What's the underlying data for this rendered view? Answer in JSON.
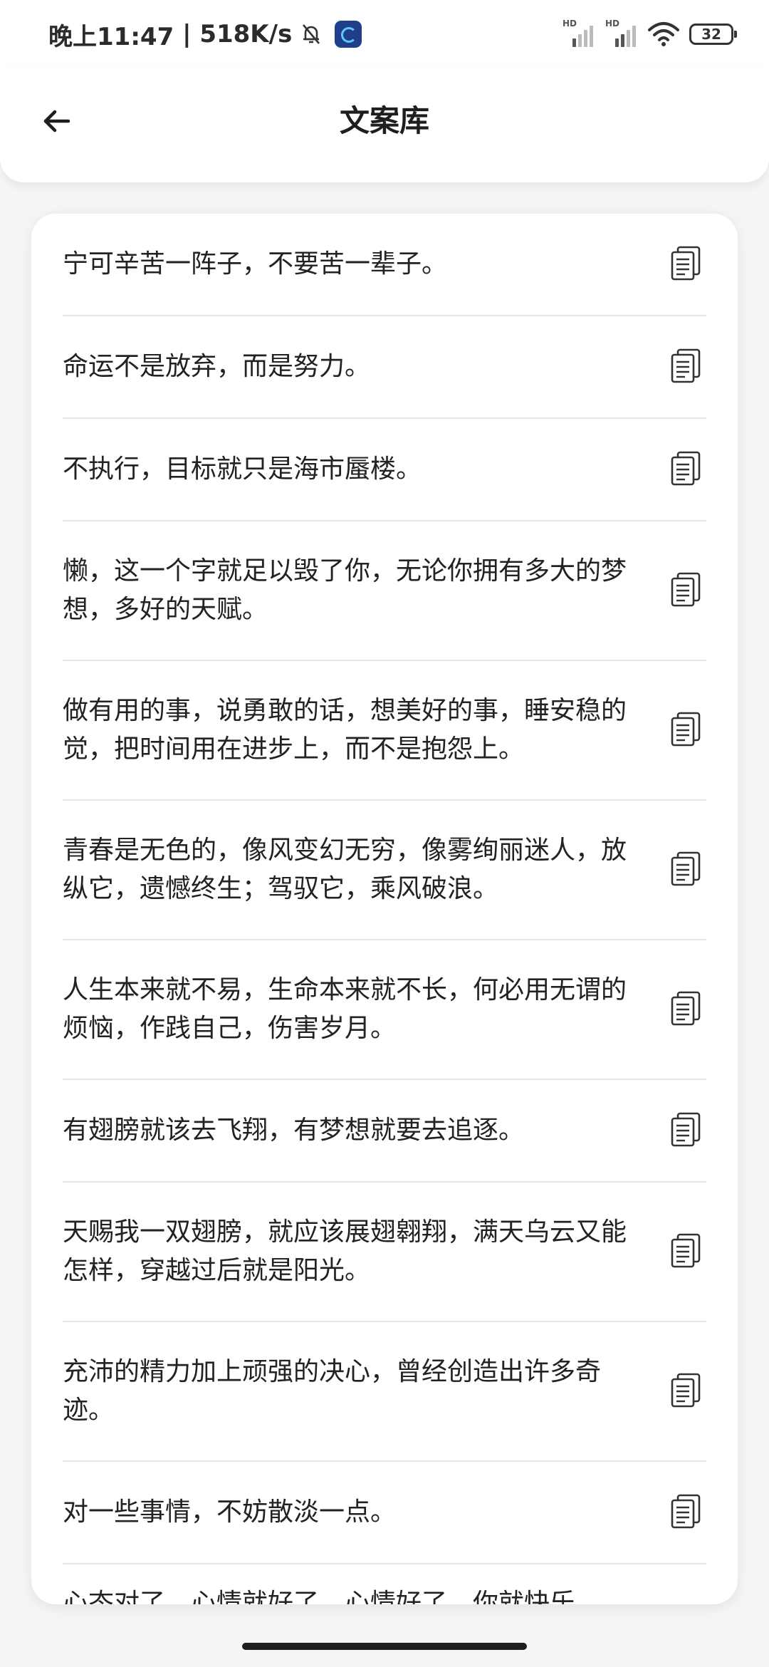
{
  "status_bar": {
    "time": "晚上11:47",
    "speed": "518K/s",
    "signal1_label": "HD",
    "signal2_label": "HD",
    "battery": "32"
  },
  "header": {
    "title": "文案库"
  },
  "quotes": [
    "宁可辛苦一阵子，不要苦一辈子。",
    "命运不是放弃，而是努力。",
    "不执行，目标就只是海市蜃楼。",
    "懒，这一个字就足以毁了你，无论你拥有多大的梦想，多好的天赋。",
    "做有用的事，说勇敢的话，想美好的事，睡安稳的觉，把时间用在进步上，而不是抱怨上。",
    "青春是无色的，像风变幻无穷，像雾绚丽迷人，放纵它，遗憾终生；驾驭它，乘风破浪。",
    "人生本来就不易，生命本来就不长，何必用无谓的烦恼，作践自己，伤害岁月。",
    "有翅膀就该去飞翔，有梦想就要去追逐。",
    "天赐我一双翅膀，就应该展翅翱翔，满天乌云又能怎样，穿越过后就是阳光。",
    "充沛的精力加上顽强的决心，曾经创造出许多奇迹。",
    "对一些事情，不妨散淡一点。",
    "心态对了，心情就好了，心情好了，你就快乐。"
  ]
}
